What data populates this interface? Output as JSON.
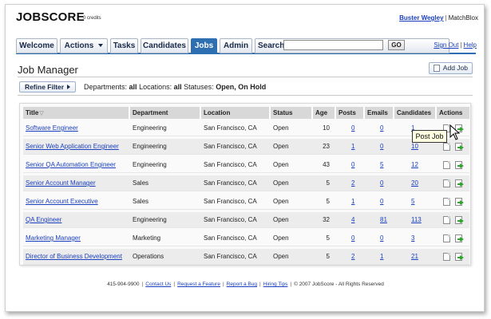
{
  "header": {
    "logo_main": "JOBSCORE",
    "credits": "0 credits",
    "user_name": "Buster Wegley",
    "company": "MatchBlox"
  },
  "nav": {
    "tabs": [
      {
        "label": "Welcome"
      },
      {
        "label": "Actions"
      },
      {
        "label": "Tasks"
      },
      {
        "label": "Candidates"
      },
      {
        "label": "Jobs"
      },
      {
        "label": "Admin"
      }
    ],
    "search_label": "Search",
    "search_value": "",
    "go_label": "GO",
    "sign_out": "Sign Out",
    "help": "Help"
  },
  "page": {
    "title": "Job Manager",
    "add_job": "Add Job"
  },
  "filter": {
    "refine_label": "Refine Filter",
    "departments_label": "Departments:",
    "departments_value": "all",
    "locations_label": "Locations:",
    "locations_value": "all",
    "statuses_label": "Statuses:",
    "statuses_value": "Open, On Hold"
  },
  "table": {
    "headers": {
      "title": "Title",
      "department": "Department",
      "location": "Location",
      "status": "Status",
      "age": "Age",
      "posts": "Posts",
      "emails": "Emails",
      "candidates": "Candidates",
      "actions": "Actions"
    },
    "rows": [
      {
        "title": "Software Engineer",
        "department": "Engineering",
        "location": "San Francisco, CA",
        "status": "Open",
        "age": "10",
        "posts": "0",
        "emails": "0",
        "candidates": "1"
      },
      {
        "title": "Senior Web Application Engineer",
        "department": "Engineering",
        "location": "San Francisco, CA",
        "status": "Open",
        "age": "23",
        "posts": "1",
        "emails": "0",
        "candidates": "10"
      },
      {
        "title": "Senior QA Automation Engineer",
        "department": "Engineering",
        "location": "San Francisco, CA",
        "status": "Open",
        "age": "43",
        "posts": "0",
        "emails": "5",
        "candidates": "12"
      },
      {
        "title": "Senior Account Manager",
        "department": "Sales",
        "location": "San Francisco, CA",
        "status": "Open",
        "age": "5",
        "posts": "2",
        "emails": "0",
        "candidates": "20"
      },
      {
        "title": "Senior Account Executive",
        "department": "Sales",
        "location": "San Francisco, CA",
        "status": "Open",
        "age": "5",
        "posts": "1",
        "emails": "0",
        "candidates": "5"
      },
      {
        "title": "QA Engineer",
        "department": "Engineering",
        "location": "San Francisco, CA",
        "status": "Open",
        "age": "32",
        "posts": "4",
        "emails": "81",
        "candidates": "113"
      },
      {
        "title": "Marketing Manager",
        "department": "Marketing",
        "location": "San Francisco, CA",
        "status": "Open",
        "age": "5",
        "posts": "0",
        "emails": "0",
        "candidates": "3"
      },
      {
        "title": "Director of Business Development",
        "department": "Operations",
        "location": "San Francisco, CA",
        "status": "Open",
        "age": "5",
        "posts": "2",
        "emails": "1",
        "candidates": "21"
      }
    ]
  },
  "tooltip": "Post Job",
  "footer": {
    "phone": "415-904-9900",
    "links": [
      "Contact Us",
      "Request a Feature",
      "Report a Bug",
      "Hiring Tips"
    ],
    "copyright": "© 2007 JobScore - All Rights Reserved"
  },
  "colors": {
    "accent": "#2d6fb1",
    "link": "#1a3fbf",
    "post_arrow": "#2fa52f"
  }
}
